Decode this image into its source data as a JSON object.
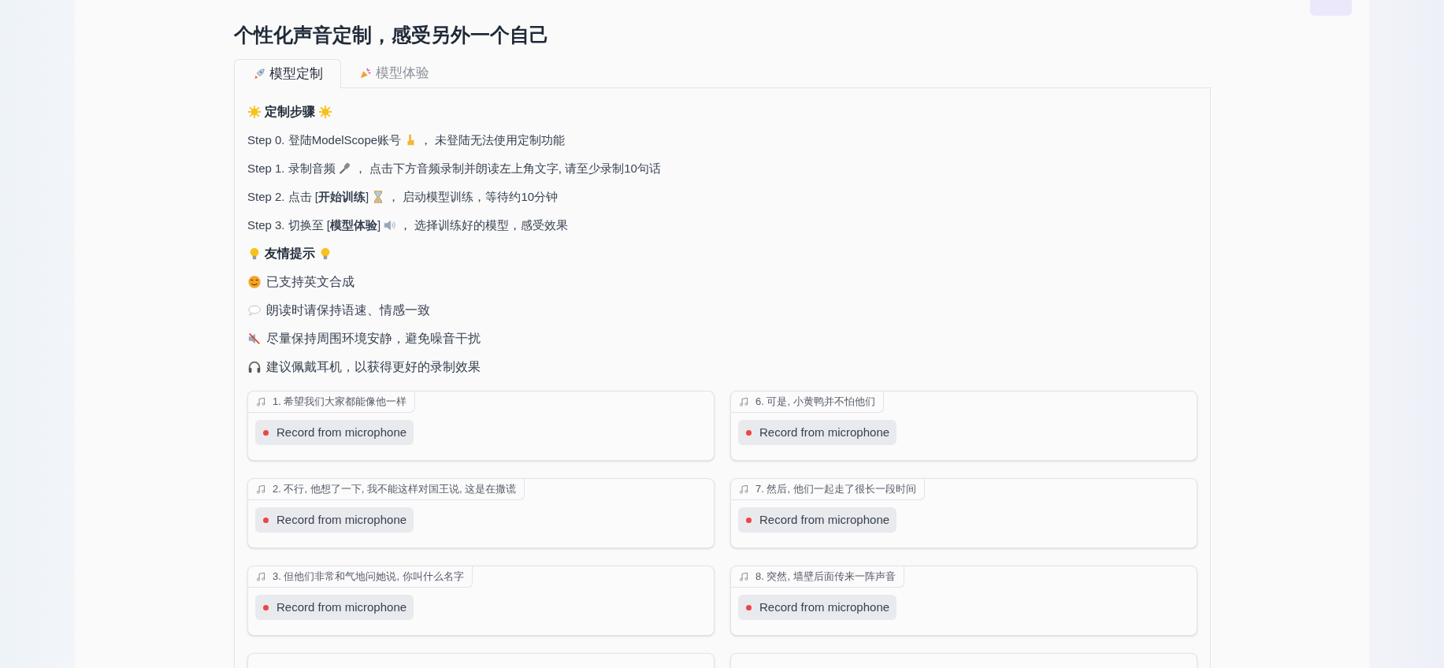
{
  "title": "个性化声音定制，感受另外一个自己",
  "tabs": [
    {
      "label": "模型定制",
      "selected": true
    },
    {
      "label": "模型体验",
      "selected": false
    }
  ],
  "steps_heading": "定制步骤",
  "steps": [
    {
      "before": "Step 0. 登陆ModelScope账号",
      "after": "，  未登陆无法使用定制功能"
    },
    {
      "before": "Step 1. 录制音频",
      "after": "，  点击下方音频录制并朗读左上角文字, 请至少录制10句话"
    },
    {
      "before": "Step 2. 点击 [**开始训练**]",
      "after": "，  启动模型训练，等待约10分钟"
    },
    {
      "before": "Step 3. 切换至 [**模型体验**]",
      "after": "，  选择训练好的模型，感受效果"
    }
  ],
  "tips_heading": "友情提示",
  "tips": [
    "已支持英文合成",
    "朗读时请保持语速、情感一致",
    "尽量保持周围环境安静，避免噪音干扰",
    "建议佩戴耳机，以获得更好的录制效果"
  ],
  "recordings": [
    {
      "label": "1. 希望我们大家都能像他一样",
      "button": "Record from microphone"
    },
    {
      "label": "6. 可是, 小黄鸭并不怕他们",
      "button": "Record from microphone"
    },
    {
      "label": "2. 不行, 他想了一下, 我不能这样对国王说, 这是在撒谎",
      "button": "Record from microphone"
    },
    {
      "label": "7. 然后, 他们一起走了很长一段时间",
      "button": "Record from microphone"
    },
    {
      "label": "3. 但他们非常和气地问她说, 你叫什么名字",
      "button": "Record from microphone"
    },
    {
      "label": "8. 突然, 墙壁后面传来一阵声音",
      "button": "Record from microphone"
    }
  ]
}
